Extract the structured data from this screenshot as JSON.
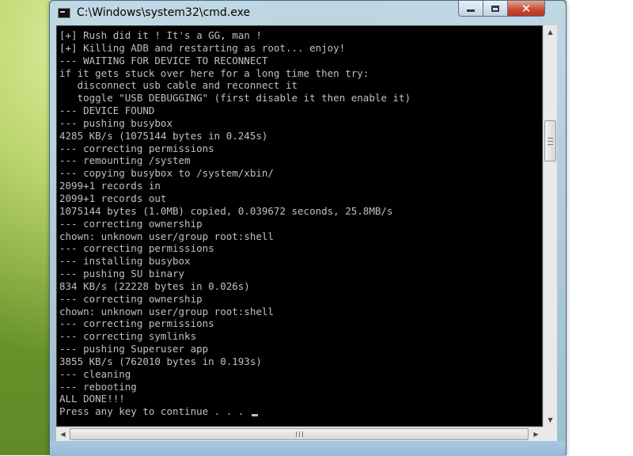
{
  "window": {
    "title": "C:\\Windows\\system32\\cmd.exe",
    "icon": "cmd-icon"
  },
  "controls": {
    "minimize_icon": "minimize-icon",
    "maximize_icon": "maximize-icon",
    "close_glyph": "✕"
  },
  "console": {
    "lines": [
      "[+] Rush did it ! It's a GG, man !",
      "[+] Killing ADB and restarting as root... enjoy!",
      "--- WAITING FOR DEVICE TO RECONNECT",
      "if it gets stuck over here for a long time then try:",
      "   disconnect usb cable and reconnect it",
      "   toggle \"USB DEBUGGING\" (first disable it then enable it)",
      "--- DEVICE FOUND",
      "--- pushing busybox",
      "4285 KB/s (1075144 bytes in 0.245s)",
      "--- correcting permissions",
      "--- remounting /system",
      "--- copying busybox to /system/xbin/",
      "2099+1 records in",
      "2099+1 records out",
      "1075144 bytes (1.0MB) copied, 0.039672 seconds, 25.8MB/s",
      "--- correcting ownership",
      "chown: unknown user/group root:shell",
      "--- correcting permissions",
      "--- installing busybox",
      "--- pushing SU binary",
      "834 KB/s (22228 bytes in 0.026s)",
      "--- correcting ownership",
      "chown: unknown user/group root:shell",
      "--- correcting permissions",
      "--- correcting symlinks",
      "--- pushing Superuser app",
      "3855 KB/s (762010 bytes in 0.193s)",
      "--- cleaning",
      "--- rebooting",
      "ALL DONE!!!",
      "Press any key to continue . . . "
    ],
    "text_color": "#c0c0c0",
    "background": "#000000"
  },
  "scrollbars": {
    "up_arrow": "▲",
    "down_arrow": "▼",
    "left_arrow": "◀",
    "right_arrow": "▶"
  },
  "colors": {
    "close_button": "#c64a31",
    "frame": "#a5c3dc"
  }
}
